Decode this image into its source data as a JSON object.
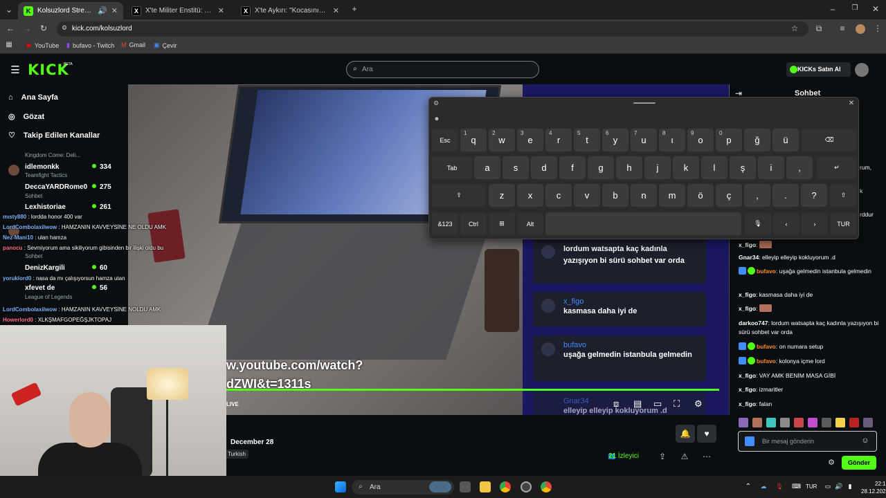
{
  "browser": {
    "tabs": [
      {
        "title": "Kolsuzlord Stream - Watch",
        "active": true
      },
      {
        "title": "X'te Militer Enstitü: \"Japonya, T…",
        "active": false
      },
      {
        "title": "X'te Aykırı: \"Kocasının cezaevin…",
        "active": false
      }
    ],
    "url": "kick.com/kolsuzlord",
    "bookmarks": [
      "YouTube",
      "bufavo - Twitch",
      "Gmail",
      "Çevir"
    ]
  },
  "header": {
    "logo": "KICK",
    "logo_badge": "BETA",
    "search_placeholder": "Ara",
    "buy_kicks": "KICKs Satın Al"
  },
  "sidebar": {
    "nav": [
      {
        "label": "Ana Sayfa",
        "icon": "home-icon"
      },
      {
        "label": "Gözat",
        "icon": "compass-icon"
      },
      {
        "label": "Takip Edilen Kanallar",
        "icon": "heart-icon"
      }
    ],
    "channels": [
      {
        "name": "",
        "category": "Kingdom Come: Deli...",
        "viewers": ""
      },
      {
        "name": "idlemonkk",
        "category": "Teamfight Tactics",
        "viewers": "334"
      },
      {
        "name": "DeccaYARDRome0",
        "category": "Sohbet",
        "viewers": "275"
      },
      {
        "name": "Lexhistoriae",
        "category": "",
        "viewers": "261"
      },
      {
        "name": "DenizKargili",
        "category": "Sohbet",
        "viewers": "60"
      },
      {
        "name": "xfevet de",
        "category": "League of Legends",
        "viewers": "56"
      }
    ],
    "overlay_chat": [
      {
        "user": "mısty880",
        "text": "lordda honor 400 var"
      },
      {
        "user": "LordCombolaxilwow",
        "text": "HAMZANIN KAVVEYSİNE NE OLDU AMK"
      },
      {
        "user": "Nez-Mani10",
        "text": "ulan hamza"
      },
      {
        "user": "panocu",
        "text": "Sevmiyorum ama sikiliyorum gibisinden bir ilişki oldu bu"
      },
      {
        "user": "yoruklord0",
        "text": "nasa da mı çalışıyorsun hamza utan"
      },
      {
        "user": "LordCombolaxilwow",
        "text": "HAMZANIN KAVVEYSİNE NOLDU AMK"
      },
      {
        "user": "Howerlord0",
        "text": "XLKŞMAFGOPEĞŞJKTOPAJ"
      }
    ]
  },
  "video": {
    "overlay_line1": "w.youtube.com/watch?",
    "overlay_line2": "dZWI&t=1311s",
    "live_label": "LIVE",
    "stream_chat": [
      {
        "user": "",
        "text": "lordum watsapta kaç kadınla yazışıyon bi sürü sohbet var orda"
      },
      {
        "user": "x_figo",
        "text": "kasmasa daha iyi de"
      },
      {
        "user": "bufavo",
        "text": "uşağa gelmedin istanbula gelmedin"
      },
      {
        "user": "Gnar34",
        "text": "elleyip elleyip kokluyorum .d"
      }
    ],
    "progress": 1.0
  },
  "below_video": {
    "date": "December 28",
    "language": "Turkish",
    "viewer_count": "21",
    "viewer_label": "İzleyici"
  },
  "chat": {
    "title": "Sohbet",
    "partial_lines": [
      "rum,",
      "k",
      "rddur"
    ],
    "messages": [
      {
        "user": "x_figo",
        "text": "",
        "color": "#ffffff",
        "emote": true
      },
      {
        "user": "Gnar34",
        "text": "elleyip elleyip kokluyorum .d",
        "color": "#ffffff"
      },
      {
        "user": "bufavo",
        "text": "uşağa gelmedin istanbula gelmedin",
        "color": "#ff8c1a",
        "badges": true
      },
      {
        "user": "x_figo",
        "text": "kasmasa daha iyi de",
        "color": "#ffffff"
      },
      {
        "user": "x_figo",
        "text": "",
        "color": "#ffffff",
        "emote": true
      },
      {
        "user": "darkoo747",
        "text": "lordum watsapta kaç kadınla yazışıyon bi sürü sohbet var orda",
        "color": "#ffffff"
      },
      {
        "user": "bufavo",
        "text": "on numara setup",
        "color": "#ff8c1a",
        "badges": true
      },
      {
        "user": "bufavo",
        "text": "kolonya içme lord",
        "color": "#ff8c1a",
        "badges": true
      },
      {
        "user": "x_figo",
        "text": "VAY AMK BENİM MASA GİBİ",
        "color": "#ffffff"
      },
      {
        "user": "x_figo",
        "text": "izmaritler",
        "color": "#ffffff"
      },
      {
        "user": "x_figo",
        "text": "falan",
        "color": "#ffffff"
      }
    ],
    "input_placeholder": "Bir mesaj gönderin",
    "send_label": "Gönder"
  },
  "keyboard": {
    "row1": [
      "Esc",
      "q",
      "w",
      "e",
      "r",
      "t",
      "y",
      "u",
      "ı",
      "o",
      "p",
      "ğ",
      "ü"
    ],
    "row1_nums": [
      "",
      "1",
      "2",
      "3",
      "4",
      "5",
      "6",
      "7",
      "8",
      "9",
      "0",
      "",
      ""
    ],
    "row2": [
      "Tab",
      "a",
      "s",
      "d",
      "f",
      "g",
      "h",
      "j",
      "k",
      "l",
      "ş",
      "i",
      ","
    ],
    "row3": [
      "z",
      "x",
      "c",
      "v",
      "b",
      "n",
      "m",
      "ö",
      "ç",
      ",",
      ".",
      "?"
    ],
    "row4": [
      "&123",
      "Ctrl",
      "",
      "Alt"
    ],
    "lang": "TUR"
  },
  "taskbar": {
    "search": "Ara",
    "tray_lang": "TUR",
    "time": "22:17",
    "date": "28.12.2025"
  },
  "colors": {
    "accent": "#53fc18",
    "link": "#3f8dff",
    "orange": "#ff8c1a"
  }
}
